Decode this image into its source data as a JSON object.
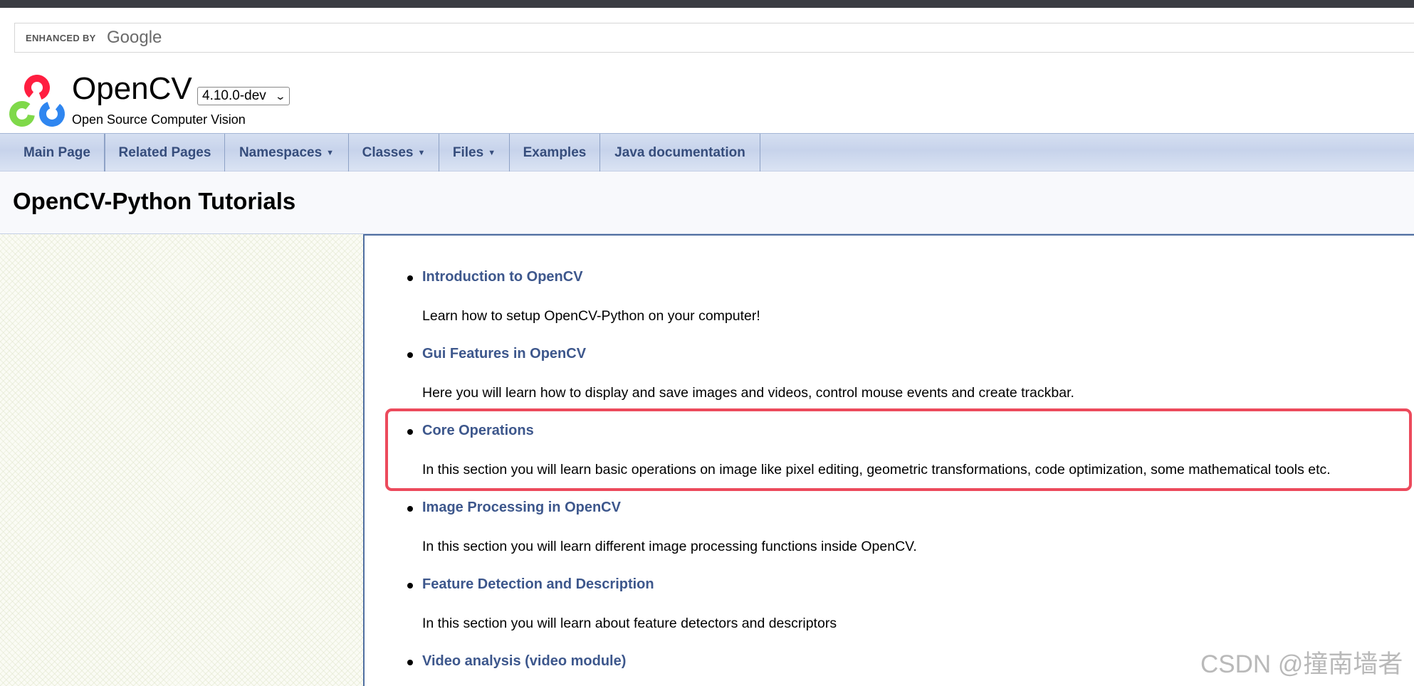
{
  "search": {
    "enhanced_by": "ENHANCED BY",
    "google": "Google"
  },
  "header": {
    "project_name": "OpenCV",
    "version": "4.10.0-dev",
    "brief": "Open Source Computer Vision"
  },
  "nav": {
    "items": [
      {
        "label": "Main Page",
        "dropdown": false
      },
      {
        "label": "Related Pages",
        "dropdown": false
      },
      {
        "label": "Namespaces",
        "dropdown": true
      },
      {
        "label": "Classes",
        "dropdown": true
      },
      {
        "label": "Files",
        "dropdown": true
      },
      {
        "label": "Examples",
        "dropdown": false
      },
      {
        "label": "Java documentation",
        "dropdown": false
      }
    ]
  },
  "page": {
    "title": "OpenCV-Python Tutorials"
  },
  "tutorials": [
    {
      "title": "Introduction to OpenCV",
      "description": "Learn how to setup OpenCV-Python on your computer!"
    },
    {
      "title": "Gui Features in OpenCV",
      "description": "Here you will learn how to display and save images and videos, control mouse events and create trackbar."
    },
    {
      "title": "Core Operations",
      "description": "In this section you will learn basic operations on image like pixel editing, geometric transformations, code optimization, some mathematical tools etc.",
      "highlighted": true
    },
    {
      "title": "Image Processing in OpenCV",
      "description": "In this section you will learn different image processing functions inside OpenCV."
    },
    {
      "title": "Feature Detection and Description",
      "description": "In this section you will learn about feature detectors and descriptors"
    },
    {
      "title": "Video analysis (video module)",
      "description": ""
    }
  ],
  "watermark": "CSDN @撞南墙者",
  "colors": {
    "link": "#3d578c",
    "nav_text": "#364d7c",
    "highlight_border": "#ec4a5c",
    "logo_red": "#ff1e40",
    "logo_green": "#7fd94a",
    "logo_blue": "#2f86f0"
  }
}
